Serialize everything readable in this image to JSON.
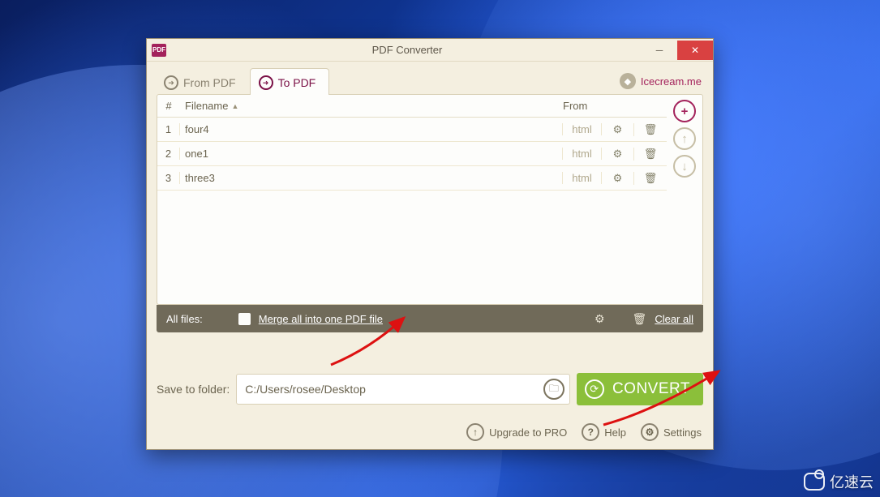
{
  "titlebar": {
    "app_badge": "PDF",
    "title": "PDF Converter"
  },
  "tabs": {
    "from_pdf": "From PDF",
    "to_pdf": "To PDF",
    "icecream_link": "Icecream.me"
  },
  "columns": {
    "num": "#",
    "filename": "Filename",
    "sort_indicator": "▲",
    "from": "From"
  },
  "rows": [
    {
      "n": "1",
      "name": "four4",
      "from": "html"
    },
    {
      "n": "2",
      "name": "one1",
      "from": "html"
    },
    {
      "n": "3",
      "name": "three3",
      "from": "html"
    }
  ],
  "allbar": {
    "label": "All files:",
    "merge": "Merge all into one PDF file",
    "clear": "Clear all"
  },
  "save": {
    "label": "Save to folder:",
    "path": "C:/Users/rosee/Desktop"
  },
  "convert": {
    "label": "CONVERT"
  },
  "footer": {
    "upgrade": "Upgrade to PRO",
    "help": "Help",
    "settings": "Settings"
  },
  "colors": {
    "accent_magenta": "#a3225b",
    "convert_green": "#8bbf3a",
    "close_red": "#d94141",
    "panel_cream": "#f4efe0",
    "allbar_gray": "#706a59"
  },
  "watermark": "亿速云"
}
